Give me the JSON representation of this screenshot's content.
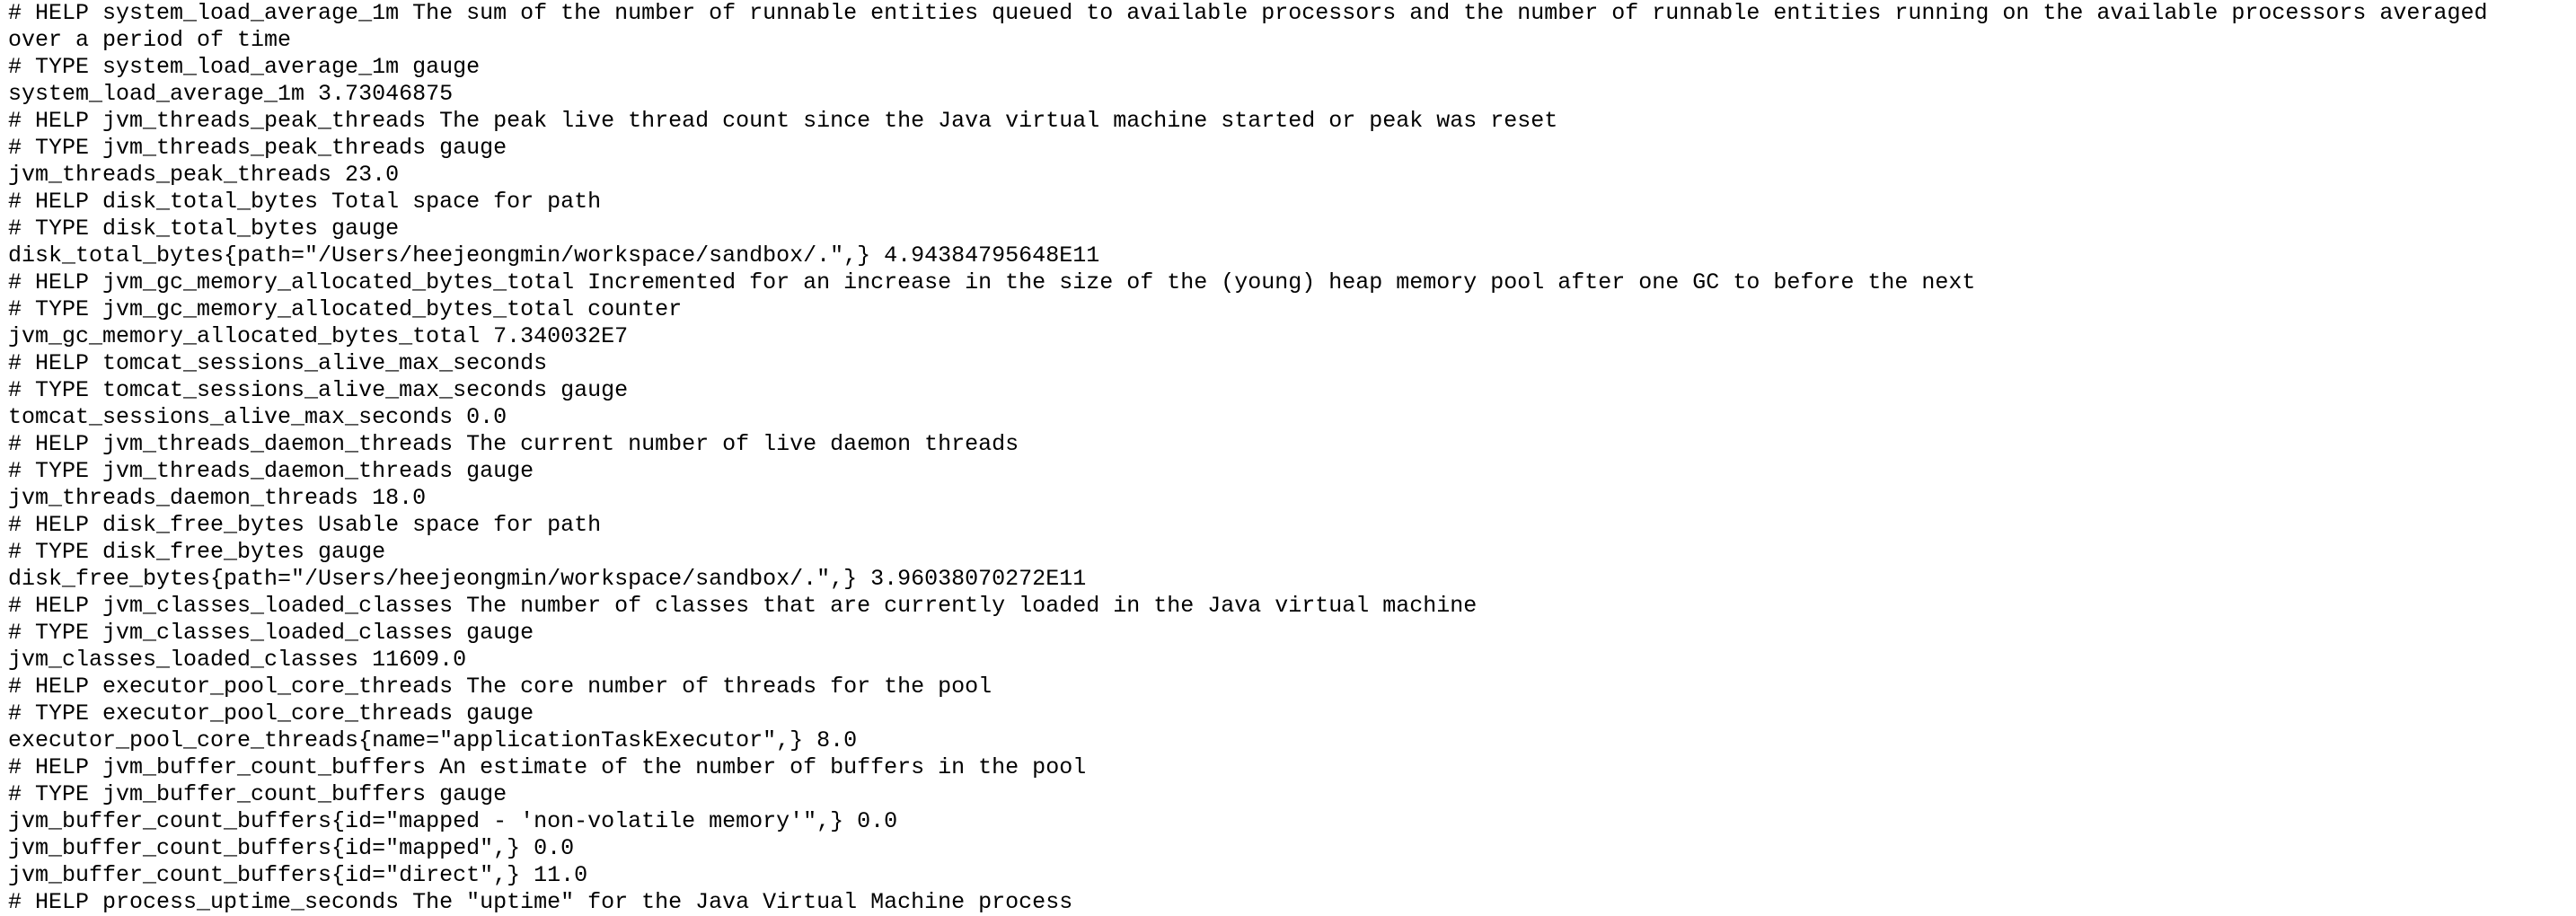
{
  "lines": [
    "# HELP system_load_average_1m The sum of the number of runnable entities queued to available processors and the number of runnable entities running on the available processors averaged",
    "over a period of time",
    "# TYPE system_load_average_1m gauge",
    "system_load_average_1m 3.73046875",
    "# HELP jvm_threads_peak_threads The peak live thread count since the Java virtual machine started or peak was reset",
    "# TYPE jvm_threads_peak_threads gauge",
    "jvm_threads_peak_threads 23.0",
    "# HELP disk_total_bytes Total space for path",
    "# TYPE disk_total_bytes gauge",
    "disk_total_bytes{path=\"/Users/heejeongmin/workspace/sandbox/.\",} 4.94384795648E11",
    "# HELP jvm_gc_memory_allocated_bytes_total Incremented for an increase in the size of the (young) heap memory pool after one GC to before the next",
    "# TYPE jvm_gc_memory_allocated_bytes_total counter",
    "jvm_gc_memory_allocated_bytes_total 7.340032E7",
    "# HELP tomcat_sessions_alive_max_seconds",
    "# TYPE tomcat_sessions_alive_max_seconds gauge",
    "tomcat_sessions_alive_max_seconds 0.0",
    "# HELP jvm_threads_daemon_threads The current number of live daemon threads",
    "# TYPE jvm_threads_daemon_threads gauge",
    "jvm_threads_daemon_threads 18.0",
    "# HELP disk_free_bytes Usable space for path",
    "# TYPE disk_free_bytes gauge",
    "disk_free_bytes{path=\"/Users/heejeongmin/workspace/sandbox/.\",} 3.96038070272E11",
    "# HELP jvm_classes_loaded_classes The number of classes that are currently loaded in the Java virtual machine",
    "# TYPE jvm_classes_loaded_classes gauge",
    "jvm_classes_loaded_classes 11609.0",
    "# HELP executor_pool_core_threads The core number of threads for the pool",
    "# TYPE executor_pool_core_threads gauge",
    "executor_pool_core_threads{name=\"applicationTaskExecutor\",} 8.0",
    "# HELP jvm_buffer_count_buffers An estimate of the number of buffers in the pool",
    "# TYPE jvm_buffer_count_buffers gauge",
    "jvm_buffer_count_buffers{id=\"mapped - 'non-volatile memory'\",} 0.0",
    "jvm_buffer_count_buffers{id=\"mapped\",} 0.0",
    "jvm_buffer_count_buffers{id=\"direct\",} 11.0",
    "# HELP process_uptime_seconds The \"uptime\" for the Java Virtual Machine process"
  ]
}
